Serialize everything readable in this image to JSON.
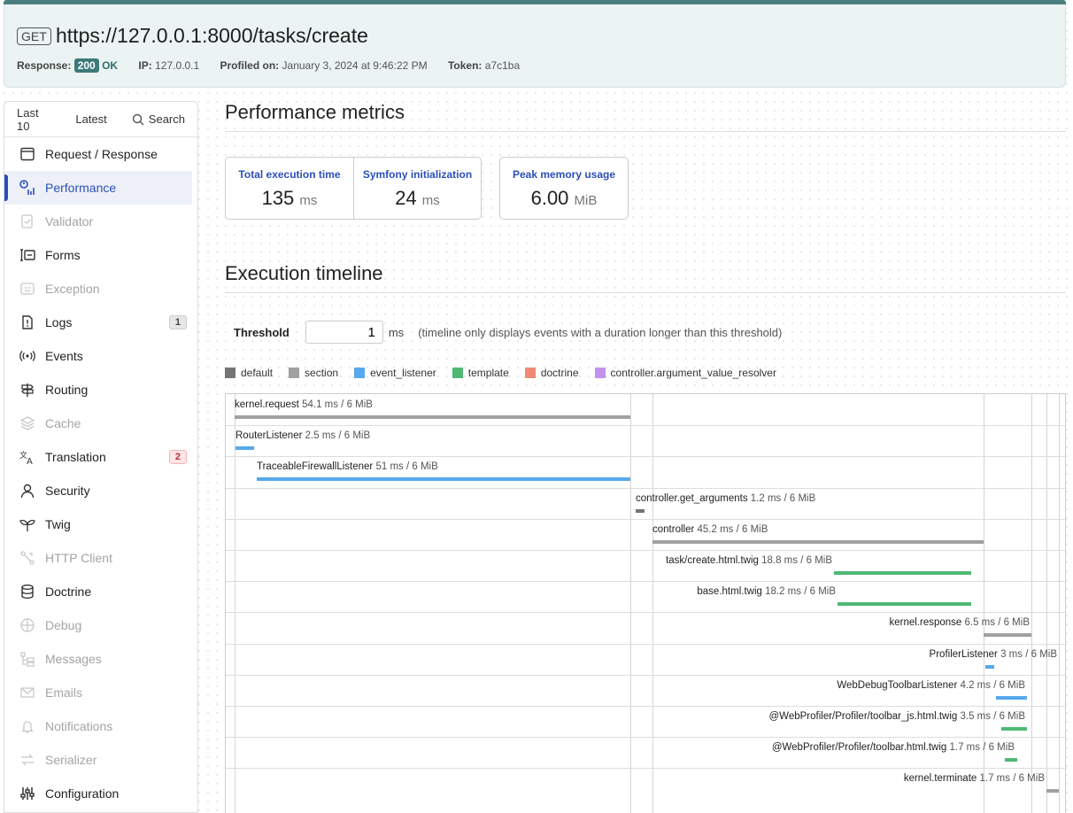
{
  "header": {
    "method": "GET",
    "url": "https://127.0.0.1:8000/tasks/create",
    "response_label": "Response:",
    "status_code": "200",
    "status_text": "OK",
    "ip_label": "IP:",
    "ip": "127.0.0.1",
    "profiled_label": "Profiled on:",
    "profiled_on": "January 3, 2024 at 9:46:22 PM",
    "token_label": "Token:",
    "token": "a7c1ba"
  },
  "sidebar": {
    "tabs": {
      "last10": "Last 10",
      "latest": "Latest",
      "search": "Search"
    },
    "items": [
      {
        "label": "Request / Response",
        "icon": "request-response-icon",
        "state": "normal"
      },
      {
        "label": "Performance",
        "icon": "performance-icon",
        "state": "active"
      },
      {
        "label": "Validator",
        "icon": "validator-icon",
        "state": "disabled"
      },
      {
        "label": "Forms",
        "icon": "forms-icon",
        "state": "normal"
      },
      {
        "label": "Exception",
        "icon": "exception-icon",
        "state": "disabled"
      },
      {
        "label": "Logs",
        "icon": "logs-icon",
        "state": "normal",
        "badge": "1"
      },
      {
        "label": "Events",
        "icon": "events-icon",
        "state": "normal"
      },
      {
        "label": "Routing",
        "icon": "routing-icon",
        "state": "normal"
      },
      {
        "label": "Cache",
        "icon": "cache-icon",
        "state": "disabled"
      },
      {
        "label": "Translation",
        "icon": "translation-icon",
        "state": "normal",
        "badge": "2"
      },
      {
        "label": "Security",
        "icon": "security-icon",
        "state": "normal"
      },
      {
        "label": "Twig",
        "icon": "twig-icon",
        "state": "normal"
      },
      {
        "label": "HTTP Client",
        "icon": "http-client-icon",
        "state": "disabled"
      },
      {
        "label": "Doctrine",
        "icon": "doctrine-icon",
        "state": "normal"
      },
      {
        "label": "Debug",
        "icon": "debug-icon",
        "state": "disabled"
      },
      {
        "label": "Messages",
        "icon": "messages-icon",
        "state": "disabled"
      },
      {
        "label": "Emails",
        "icon": "emails-icon",
        "state": "disabled"
      },
      {
        "label": "Notifications",
        "icon": "notifications-icon",
        "state": "disabled"
      },
      {
        "label": "Serializer",
        "icon": "serializer-icon",
        "state": "disabled"
      },
      {
        "label": "Configuration",
        "icon": "configuration-icon",
        "state": "normal"
      }
    ]
  },
  "main": {
    "title": "Performance metrics",
    "metrics": {
      "total_label": "Total execution time",
      "total_value": "135",
      "total_unit": "ms",
      "init_label": "Symfony initialization",
      "init_value": "24",
      "init_unit": "ms",
      "memory_label": "Peak memory usage",
      "memory_value": "6.00",
      "memory_unit": "MiB"
    },
    "timeline_title": "Execution timeline",
    "threshold": {
      "label": "Threshold",
      "value": "1",
      "unit": "ms",
      "hint": "(timeline only displays events with a duration longer than this threshold)"
    },
    "legend": [
      {
        "name": "default",
        "color": "#757575"
      },
      {
        "name": "section",
        "color": "#a0a0a0"
      },
      {
        "name": "event_listener",
        "color": "#56a9ec"
      },
      {
        "name": "template",
        "color": "#4fb975"
      },
      {
        "name": "doctrine",
        "color": "#f08a75"
      },
      {
        "name": "controller.argument_value_resolver",
        "color": "#c391ee"
      }
    ],
    "events": [
      {
        "name": "kernel.request",
        "detail": "54.1 ms / 6 MiB",
        "category": "section"
      },
      {
        "name": "RouterListener",
        "detail": "2.5 ms / 6 MiB",
        "category": "event_listener"
      },
      {
        "name": "TraceableFirewallListener",
        "detail": "51 ms / 6 MiB",
        "category": "event_listener"
      },
      {
        "name": "controller.get_arguments",
        "detail": "1.2 ms / 6 MiB",
        "category": "default"
      },
      {
        "name": "controller",
        "detail": "45.2 ms / 6 MiB",
        "category": "section"
      },
      {
        "name": "task/create.html.twig",
        "detail": "18.8 ms / 6 MiB",
        "category": "template"
      },
      {
        "name": "base.html.twig",
        "detail": "18.2 ms / 6 MiB",
        "category": "template"
      },
      {
        "name": "kernel.response",
        "detail": "6.5 ms / 6 MiB",
        "category": "section"
      },
      {
        "name": "ProfilerListener",
        "detail": "3 ms / 6 MiB",
        "category": "event_listener"
      },
      {
        "name": "WebDebugToolbarListener",
        "detail": "4.2 ms / 6 MiB",
        "category": "event_listener"
      },
      {
        "name": "@WebProfiler/Profiler/toolbar_js.html.twig",
        "detail": "3.5 ms / 6 MiB",
        "category": "template"
      },
      {
        "name": "@WebProfiler/Profiler/toolbar.html.twig",
        "detail": "1.7 ms / 6 MiB",
        "category": "template"
      },
      {
        "name": "kernel.terminate",
        "detail": "1.7 ms / 6 MiB",
        "category": "section"
      }
    ]
  }
}
